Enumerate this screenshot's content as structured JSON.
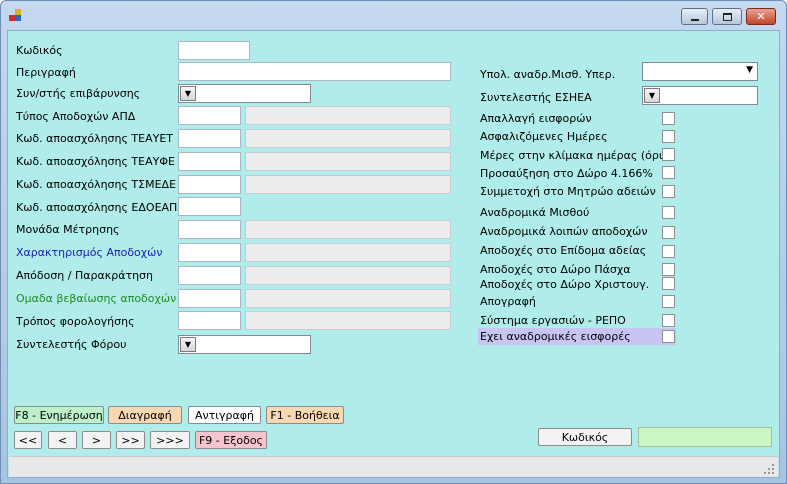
{
  "window": {
    "controls": {
      "minimize": "minimize-icon",
      "maximize": "maximize-icon",
      "close": "close-icon"
    }
  },
  "left_fields": {
    "kodikos": "Κωδικός",
    "perigrafi": "Περιγραφή",
    "syntelestis_epivarynsis": "Συν/στής επιβάρυνσης",
    "typos_apodoxon": "Τύπος Αποδοχών ΑΠΔ",
    "kod_teayet": "Κωδ. αποασχόλησης ΤΕΑΥΕΤ",
    "kod_teayfe": "Κωδ. αποασχόλησης ΤΕΑΥΦΕ",
    "kod_tsmede": "Κωδ. αποασχόλησης ΤΣΜΕΔΕ",
    "kod_edoeap": "Κωδ. αποασχόλησης ΕΔΟΕΑΠ",
    "monada": "Μονάδα Μέτρησης",
    "xaraktirismos": "Χαρακτηρισμός Αποδοχών",
    "apodosi": "Απόδοση / Παρακράτηση",
    "omada": "Ομαδα βεβαίωσης αποδοχών",
    "tropos": "Τρόπος φορολογήσης",
    "syntelestis_forou": "Συντελεστής Φόρου"
  },
  "right_fields": {
    "ypol_anadr": "Υπολ. αναδρ.Μισθ. Υπερ.",
    "syntelestis_eshea": "Συντελεστής ΕΣΗΕΑ"
  },
  "checkboxes": [
    {
      "label": "Απαλλαγή εισφορών",
      "checked": false
    },
    {
      "label": "Ασφαλιζόμενες Ημέρες",
      "checked": false
    },
    {
      "label": "Μέρες στην κλίμακα ημέρας (όριο)",
      "checked": false
    },
    {
      "label": "Προσαύξηση στο Δώρο 4.166%",
      "checked": false
    },
    {
      "label": "Συμμετοχή στο Μητρώο αδειών",
      "checked": false
    },
    {
      "label": "Αναδρομικά Μισθού",
      "checked": false
    },
    {
      "label": "Αναδρομικά λοιπών αποδοχών",
      "checked": false
    },
    {
      "label": "Αποδοχές στο Επίδομα αδείας",
      "checked": false
    },
    {
      "label": "Αποδοχές στο Δώρο Πάσχα",
      "checked": false
    },
    {
      "label": "Αποδοχές στο Δώρο Χριστουγ.",
      "checked": false
    },
    {
      "label": "Απογραφή",
      "checked": false
    },
    {
      "label": "Σύστημα εργασιών - ΡΕΠΟ",
      "checked": false
    },
    {
      "label": "Εχει αναδρομικές εισφορές",
      "checked": false
    }
  ],
  "buttons": {
    "f8": "F8 - Ενημέρωση",
    "delete": "Διαγραφή",
    "copy": "Αντιγραφή",
    "f1": "F1 - Βοήθεια",
    "first": "<<",
    "prev": "<",
    "next": ">",
    "next_page": ">>",
    "last": ">>>",
    "f9": "F9 - Εξοδος",
    "search_by": "Κωδικός"
  },
  "colors": {
    "client_bg": "#b0ece9",
    "f8_bg": "#bff0cc",
    "delete_bg": "#f7d8b2",
    "f9_bg": "#f7c3cf",
    "search_field_bg": "#cbf5c2",
    "highlight_row": "#c8c4f4"
  }
}
